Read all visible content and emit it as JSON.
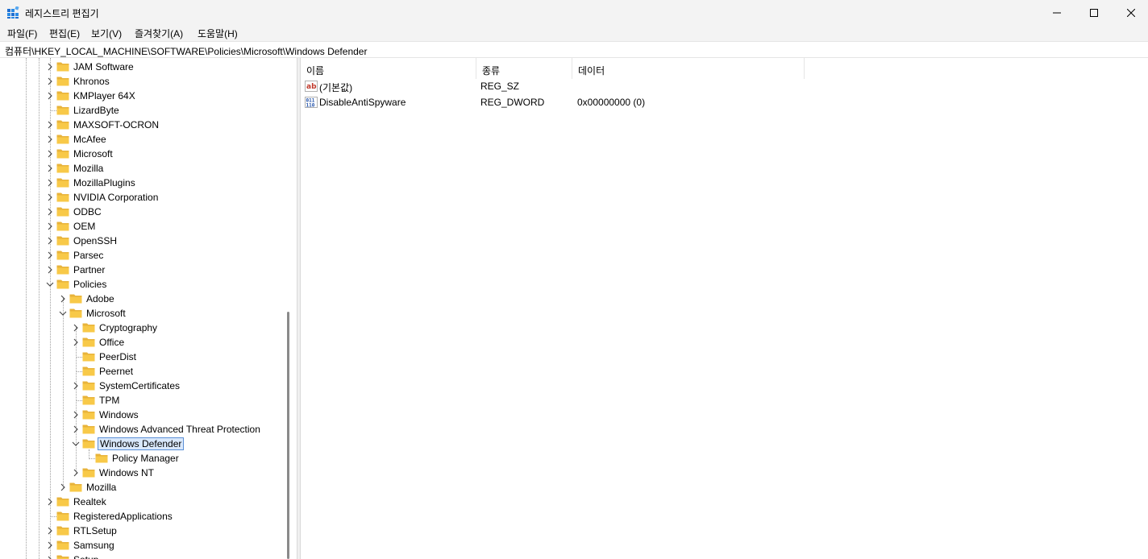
{
  "window": {
    "title": "레지스트리 편집기",
    "icon": "registry-editor-icon",
    "controls": [
      "minimize-icon",
      "maximize-icon",
      "close-icon"
    ]
  },
  "menu": [
    "파일(F)",
    "편집(E)",
    "보기(V)",
    "즐겨찾기(A)",
    "도움말(H)"
  ],
  "address": "컴퓨터\\HKEY_LOCAL_MACHINE\\SOFTWARE\\Policies\\Microsoft\\Windows Defender",
  "tree": [
    {
      "label": "JAM Software",
      "level": 0,
      "expander": "collapsed"
    },
    {
      "label": "Khronos",
      "level": 0,
      "expander": "collapsed"
    },
    {
      "label": "KMPlayer 64X",
      "level": 0,
      "expander": "collapsed"
    },
    {
      "label": "LizardByte",
      "level": 0,
      "expander": "none"
    },
    {
      "label": "MAXSOFT-OCRON",
      "level": 0,
      "expander": "collapsed"
    },
    {
      "label": "McAfee",
      "level": 0,
      "expander": "collapsed"
    },
    {
      "label": "Microsoft",
      "level": 0,
      "expander": "collapsed"
    },
    {
      "label": "Mozilla",
      "level": 0,
      "expander": "collapsed"
    },
    {
      "label": "MozillaPlugins",
      "level": 0,
      "expander": "collapsed"
    },
    {
      "label": "NVIDIA Corporation",
      "level": 0,
      "expander": "collapsed"
    },
    {
      "label": "ODBC",
      "level": 0,
      "expander": "collapsed"
    },
    {
      "label": "OEM",
      "level": 0,
      "expander": "collapsed"
    },
    {
      "label": "OpenSSH",
      "level": 0,
      "expander": "collapsed"
    },
    {
      "label": "Parsec",
      "level": 0,
      "expander": "collapsed"
    },
    {
      "label": "Partner",
      "level": 0,
      "expander": "collapsed"
    },
    {
      "label": "Policies",
      "level": 0,
      "expander": "expanded"
    },
    {
      "label": "Adobe",
      "level": 1,
      "expander": "collapsed"
    },
    {
      "label": "Microsoft",
      "level": 1,
      "expander": "expanded"
    },
    {
      "label": "Cryptography",
      "level": 2,
      "expander": "collapsed"
    },
    {
      "label": "Office",
      "level": 2,
      "expander": "collapsed"
    },
    {
      "label": "PeerDist",
      "level": 2,
      "expander": "none"
    },
    {
      "label": "Peernet",
      "level": 2,
      "expander": "none"
    },
    {
      "label": "SystemCertificates",
      "level": 2,
      "expander": "collapsed"
    },
    {
      "label": "TPM",
      "level": 2,
      "expander": "none"
    },
    {
      "label": "Windows",
      "level": 2,
      "expander": "collapsed"
    },
    {
      "label": "Windows Advanced Threat Protection",
      "level": 2,
      "expander": "collapsed"
    },
    {
      "label": "Windows Defender",
      "level": 2,
      "expander": "expanded",
      "selected": true
    },
    {
      "label": "Policy Manager",
      "level": 3,
      "expander": "none"
    },
    {
      "label": "Windows NT",
      "level": 2,
      "expander": "collapsed"
    },
    {
      "label": "Mozilla",
      "level": 1,
      "expander": "collapsed"
    },
    {
      "label": "Realtek",
      "level": 0,
      "expander": "collapsed"
    },
    {
      "label": "RegisteredApplications",
      "level": 0,
      "expander": "none"
    },
    {
      "label": "RTLSetup",
      "level": 0,
      "expander": "collapsed"
    },
    {
      "label": "Samsung",
      "level": 0,
      "expander": "collapsed"
    },
    {
      "label": "Setup",
      "level": 0,
      "expander": "collapsed"
    }
  ],
  "list": {
    "columns": [
      "이름",
      "종류",
      "데이터"
    ],
    "rows": [
      {
        "name": "(기본값)",
        "type": "REG_SZ",
        "data": "",
        "icon": "string-value-icon"
      },
      {
        "name": "DisableAntiSpyware",
        "type": "REG_DWORD",
        "data": "0x00000000 (0)",
        "icon": "binary-value-icon"
      }
    ]
  },
  "colors": {
    "titlebar": "#f3f3f3",
    "folder": "#f8c948",
    "selection_border": "#5a8fd6",
    "selection_fill": "#d9e8fb"
  }
}
